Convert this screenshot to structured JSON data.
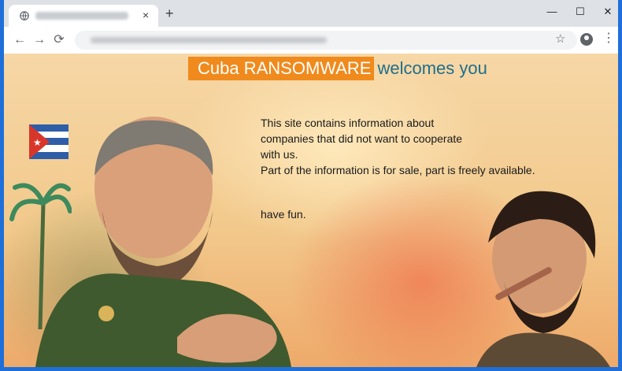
{
  "browser": {
    "tab_close": "×",
    "new_tab": "+",
    "window_controls": {
      "minimize": "—",
      "maximize": "☐",
      "close": "✕"
    },
    "nav": {
      "back": "←",
      "forward": "→",
      "reload": "⟳"
    },
    "star": "☆",
    "menu": "⋮",
    "icons": [
      "globe-icon",
      "back-arrow-icon",
      "forward-arrow-icon",
      "reload-icon",
      "star-icon",
      "account-icon",
      "kebab-menu-icon"
    ]
  },
  "page": {
    "headline_part1": "Cuba RANSOMWARE",
    "headline_part2": "welcomes you",
    "lines": [
      "This site contains information about",
      "companies that did not want to cooperate",
      "with us.",
      "Part of the information is for sale, part is freely available."
    ],
    "closing": "have fun.",
    "colors": {
      "headline_bg": "#f08a1c",
      "headline_accent": "#1f6e8c",
      "frame": "#1e6fd9"
    }
  }
}
